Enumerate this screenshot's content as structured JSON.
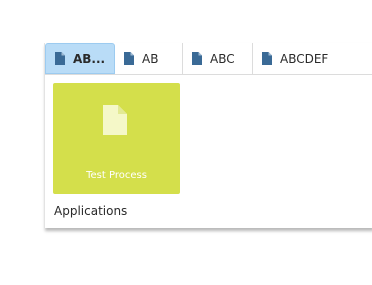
{
  "tabs": [
    {
      "label": "AB...",
      "icon": "document-icon",
      "active": true
    },
    {
      "label": "AB",
      "icon": "document-icon",
      "active": false
    },
    {
      "label": "ABC",
      "icon": "document-icon",
      "active": false
    },
    {
      "label": "ABCDEF",
      "icon": "document-icon",
      "active": false
    }
  ],
  "tile": {
    "label": "Test Process",
    "icon": "document-icon",
    "color": "#d4df4b"
  },
  "section": {
    "label": "Applications"
  },
  "colors": {
    "active_tab": "#b9dcf7",
    "doc_icon": "#3a6a96",
    "tile_icon": "#f5f8c8"
  }
}
